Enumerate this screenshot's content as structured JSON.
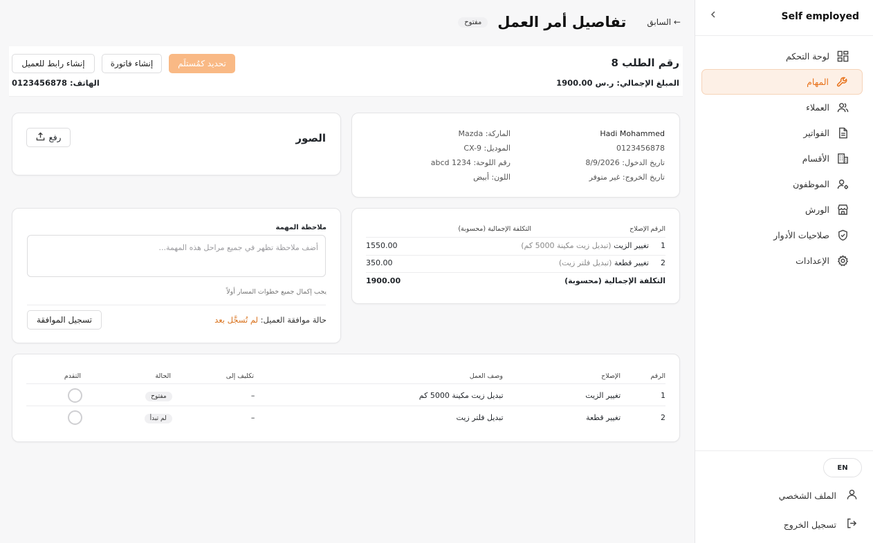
{
  "sidebar": {
    "title": "Self employed",
    "items": [
      {
        "label": "لوحة التحكم",
        "icon": "dashboard-icon"
      },
      {
        "label": "المهام",
        "icon": "wrench-icon"
      },
      {
        "label": "العملاء",
        "icon": "users-icon"
      },
      {
        "label": "الفواتير",
        "icon": "invoice-icon"
      },
      {
        "label": "الأقسام",
        "icon": "building-icon"
      },
      {
        "label": "الموظفون",
        "icon": "user-gear-icon"
      },
      {
        "label": "الورش",
        "icon": "store-icon"
      },
      {
        "label": "صلاحيات الأدوار",
        "icon": "shield-icon"
      },
      {
        "label": "الإعدادات",
        "icon": "gear-icon"
      }
    ],
    "lang": "EN",
    "profile": "الملف الشخصي",
    "logout": "تسجيل الخروج"
  },
  "header": {
    "back": "← السابق",
    "title": "تفاصيل أمر العمل",
    "status": "مفتوح"
  },
  "order": {
    "number": "رقم الطلب 8",
    "total": "المبلغ الإجمالي: ر.س 1900.00",
    "phone": "الهاتف: 0123456878",
    "btn_update": "تحديد كمُستلَم",
    "btn_invoice": "إنشاء فاتورة",
    "btn_link": "إنشاء رابط للعميل"
  },
  "customer": {
    "name": "Hadi Mohammed",
    "phone": "0123456878",
    "entry_date": "تاريخ الدخول: 8/9/2026",
    "exit_date": "تاريخ الخروج: غير متوفر",
    "brand": "الماركة: Mazda",
    "model": "الموديل: CX-9",
    "plate": "رقم اللوحة: abcd 1234",
    "color": "اللون: أبيض"
  },
  "photos": {
    "title": "الصور",
    "upload": "رفع"
  },
  "repairs": {
    "headers": [
      "الرقم",
      "الإصلاح",
      "التكلفة الإجمالية (محسوبة)"
    ],
    "rows": [
      {
        "num": "1",
        "name": "تغيير الزيت",
        "detail": "(تبديل زيت مكينة 5000 كم)",
        "cost": "1550.00"
      },
      {
        "num": "2",
        "name": "تغيير قطعة",
        "detail": "(تبديل فلتر زيت)",
        "cost": "350.00"
      }
    ],
    "total_label": "التكلفة الإجمالية (محسوبة)",
    "total_value": "1900.00"
  },
  "note": {
    "label": "ملاحظة المهمة",
    "placeholder": "أضف ملاحظة تظهر في جميع مراحل هذه المهمة...",
    "hint": "يجب إكمال جميع خطوات المسار أولاً",
    "approval_label": "حالة موافقة العميل:",
    "approval_value": "لم تُسجَّل بعد",
    "approval_button": "تسجيل الموافقة"
  },
  "tasks": {
    "headers": [
      "الرقم",
      "الإصلاح",
      "وصف العمل",
      "تكليف إلى",
      "الحالة",
      "التقدم"
    ],
    "rows": [
      {
        "num": "1",
        "repair": "تغيير الزيت",
        "desc": "تبديل زيت مكينة 5000 كم",
        "assignee": "–",
        "status": "مفتوح"
      },
      {
        "num": "2",
        "repair": "تغيير قطعة",
        "desc": "تبديل فلتر زيت",
        "assignee": "–",
        "status": "لم تبدأ"
      }
    ]
  },
  "colors": {
    "accent": "#e8731c",
    "primary_button": "#f9b985",
    "approval_text": "#d9731f"
  }
}
